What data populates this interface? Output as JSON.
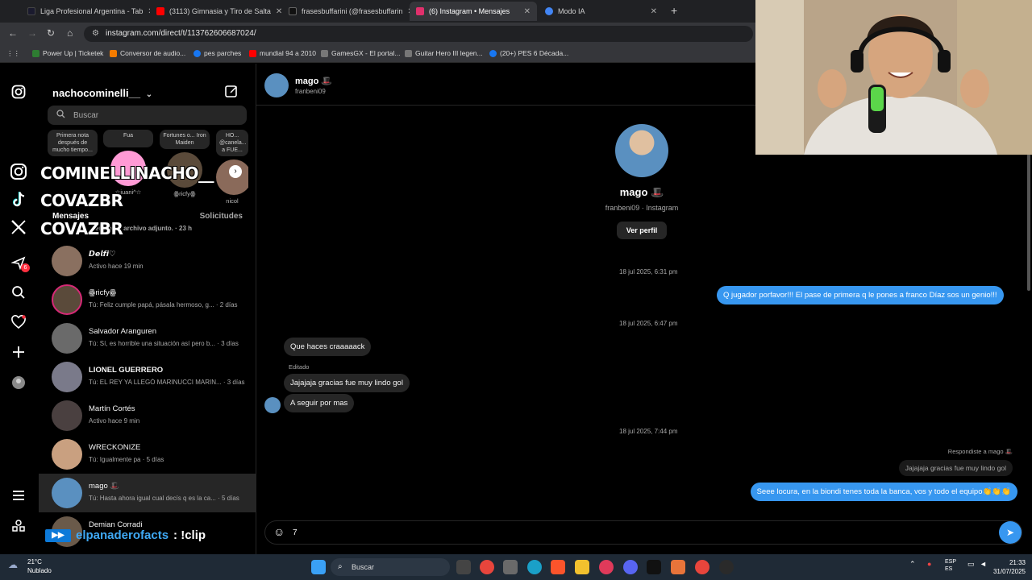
{
  "browser": {
    "tabs": [
      {
        "label": "Liga Profesional Argentina - Tab",
        "color": "#1a1a2e"
      },
      {
        "label": "(3113) Gimnasia y Tiro de Salta",
        "color": "#ff0000"
      },
      {
        "label": "frasesbuffarini (@frasesbuffarin",
        "color": "#111111"
      },
      {
        "label": "(6) Instagram • Mensajes",
        "color": "#e1306c"
      },
      {
        "label": "Modo IA",
        "color": "#4285f4"
      }
    ],
    "new_tab": "+",
    "url": "instagram.com/direct/t/113762606687024/",
    "bookmarks": [
      {
        "label": "Power Up | Ticketek",
        "color": "#2e7d32"
      },
      {
        "label": "Conversor de audio...",
        "color": "#f57c00"
      },
      {
        "label": "pes parches",
        "color": "#1877f2"
      },
      {
        "label": "mundial 94 a 2010",
        "color": "#ff0000"
      },
      {
        "label": "GamesGX - El portal...",
        "color": "#777777"
      },
      {
        "label": "Guitar Hero III legen...",
        "color": "#777777"
      },
      {
        "label": "(20+) PES 6 Década...",
        "color": "#1877f2"
      }
    ]
  },
  "sidebar": {
    "username": "nachocominelli__",
    "chevron": "⌄",
    "search_placeholder": "Buscar",
    "stories": [
      {
        "note": "Primera nota después de mucho tiempo...",
        "name": "",
        "color": "#4a4a4a"
      },
      {
        "note": "Fua",
        "name": "☆juani^☆",
        "color": "#ff9ad5"
      },
      {
        "note": "Fortunes o... Iron Maiden",
        "name": "ꙮricfyꙮ",
        "color": "#5a4a3a"
      },
      {
        "note": "HO... @canela... a FUE...",
        "name": "nicol",
        "color": "#8a6a5a"
      }
    ],
    "messages_heading": "Mensajes",
    "requests_heading": "Solicitudes",
    "first_preview": "envió un archivo adjunto. · 23 h",
    "conversations": [
      {
        "name": "𝘿𝙚𝙡𝙛𝙞♡",
        "sub": "Activo hace 19 min",
        "color": "#8a7060"
      },
      {
        "name": "ꙮricfyꙮ",
        "sub": "Tú: Feliz cumple papá, pásala hermoso, g... · 2 días",
        "color": "#5a4a3a"
      },
      {
        "name": "Salvador Aranguren",
        "sub": "Tú: Sí, es horrible una situación así pero b... · 3 días",
        "color": "#6a6a6a"
      },
      {
        "name": "LIONEL GUERRERO",
        "sub": "Tú: EL REY YA LLEGÓ MARINUCCI MARIN... · 3 días",
        "color": "#7a7a8a"
      },
      {
        "name": "Martín Cortés",
        "sub": "Activo hace 9 min",
        "color": "#4a4040"
      },
      {
        "name": "WRECKONIZE",
        "sub": "Tú: Igualmente pa · 5 días",
        "color": "#c9a080"
      },
      {
        "name": "mago 🎩",
        "sub": "Tú: Hasta ahora igual cual decís q es la ca... · 5 días",
        "color": "#5a90c0"
      },
      {
        "name": "Demian Corradi",
        "sub": "",
        "color": "#6a5a4a"
      }
    ]
  },
  "overlay": {
    "instagram": "COMINELLINACHO__",
    "tiktok": "COVAZBR",
    "x": "COVAZBR"
  },
  "rail_badge": "6",
  "chat": {
    "header_name": "mago 🎩",
    "header_user": "franbeni09",
    "profile_name": "mago 🎩",
    "profile_sub": "franbeni09 · Instagram",
    "profile_button": "Ver perfil",
    "stamp1": "18 jul 2025, 6:31 pm",
    "out1": "Q jugador porfavor!!! El pase de primera q le pones a franco Díaz sos un genio!!!",
    "stamp2": "18 jul 2025, 6:47 pm",
    "in1": "Que haces craaaaack",
    "edited": "Editado",
    "in2": "Jajajaja gracias fue muy lindo gol",
    "in3": "A seguir por mas",
    "stamp3": "18 jul 2025, 7:44 pm",
    "reply_label": "Respondiste a mago 🎩",
    "reply_quote": "Jajajaja gracias fue muy lindo gol",
    "out2": "Seee locura, en la biondi tenes toda la banca, vos y todo el equipo👏👏👏",
    "composer_value": "7"
  },
  "clip": {
    "user": "elpanaderofacts",
    "message": ": !clip"
  },
  "taskbar": {
    "temp": "21°C",
    "weather": "Nublado",
    "search": "Buscar",
    "lang1": "ESP",
    "lang2": "ES",
    "time": "21:33",
    "date": "31/07/2025"
  }
}
